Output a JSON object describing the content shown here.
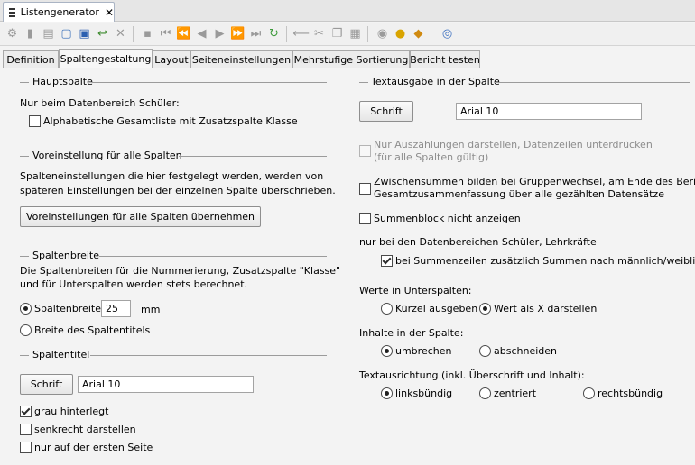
{
  "window": {
    "tab_title": "Listengenerator",
    "close_glyph": "✕"
  },
  "toolbar": {
    "icons": [
      "gear-icon",
      "book-icon",
      "copy-doc-icon",
      "new-doc-icon",
      "save-icon",
      "undo-icon",
      "delete-icon",
      "panel-icon",
      "first-icon",
      "prev-page-icon",
      "prev-icon",
      "next-icon",
      "next-page-icon",
      "last-icon",
      "refresh-icon",
      "remove-icon",
      "cut-icon",
      "copy-icon",
      "paste-icon",
      "eye-icon",
      "lightbulb-icon",
      "bell-icon",
      "help-icon"
    ]
  },
  "tabs": [
    "Definition",
    "Spaltengestaltung",
    "Layout",
    "Seiteneinstellungen",
    "Mehrstufige Sortierung",
    "Bericht testen"
  ],
  "active_tab": "Spaltengestaltung",
  "left": {
    "hauptspalte": {
      "title": "Hauptspalte",
      "note": "Nur beim Datenbereich Schüler:",
      "alphabetisch_label": "Alphabetische Gesamtliste mit Zusatzspalte Klasse",
      "alphabetisch_checked": false
    },
    "voreinstellung": {
      "title": "Voreinstellung für alle Spalten",
      "desc_line1": "Spalteneinstellungen die hier festgelegt werden, werden von",
      "desc_line2": "späteren Einstellungen bei der einzelnen Spalte überschrieben.",
      "button_label": "Voreinstellungen für alle Spalten übernehmen"
    },
    "spaltenbreite": {
      "title": "Spaltenbreite",
      "desc_line1": "Die Spaltenbreiten für die Nummerierung, Zusatzspalte \"Klasse\"",
      "desc_line2": "und für Unterspalten werden stets berechnet.",
      "option_width_label": "Spaltenbreite",
      "width_value": "25",
      "unit": "mm",
      "option_title_label": "Breite des Spaltentitels",
      "selected": "Spaltenbreite"
    },
    "spaltentitel": {
      "title": "Spaltentitel",
      "font_button": "Schrift",
      "font_value": "Arial 10",
      "grau_label": "grau hinterlegt",
      "grau_checked": true,
      "senkrecht_label": "senkrecht darstellen",
      "senkrecht_checked": false,
      "erste_seite_label": "nur auf der ersten Seite",
      "erste_seite_checked": false
    }
  },
  "right": {
    "textausgabe": {
      "title": "Textausgabe in der Spalte",
      "font_button": "Schrift",
      "font_value": "Arial 10"
    },
    "nur_auszaehlungen_line1": "Nur Auszählungen darstellen, Datenzeilen unterdrücken",
    "nur_auszaehlungen_line2": "(für alle Spalten gültig)",
    "zwischensummen_line1": "Zwischensummen bilden bei Gruppenwechsel, am Ende des Berichts",
    "zwischensummen_line2": "Gesamtzusammenfassung über alle gezählten Datensätze",
    "summenblock_label": "Summenblock nicht anzeigen",
    "datenbereiche_note": "nur bei den Datenbereichen Schüler, Lehrkräfte",
    "summenzeilen_label": "bei Summenzeilen zusätzlich Summen nach männlich/weiblich",
    "summenzeilen_checked": true,
    "unterspalten": {
      "label": "Werte in Unterspalten:",
      "options": [
        "Kürzel ausgeben",
        "Wert als X darstellen"
      ],
      "selected": "Wert als X darstellen"
    },
    "inhalte": {
      "label": "Inhalte in der Spalte:",
      "options": [
        "umbrechen",
        "abschneiden"
      ],
      "selected": "umbrechen"
    },
    "ausrichtung": {
      "label": "Textausrichtung (inkl. Überschrift und Inhalt):",
      "options": [
        "linksbündig",
        "zentriert",
        "rechtsbündig"
      ],
      "selected": "linksbündig"
    }
  }
}
